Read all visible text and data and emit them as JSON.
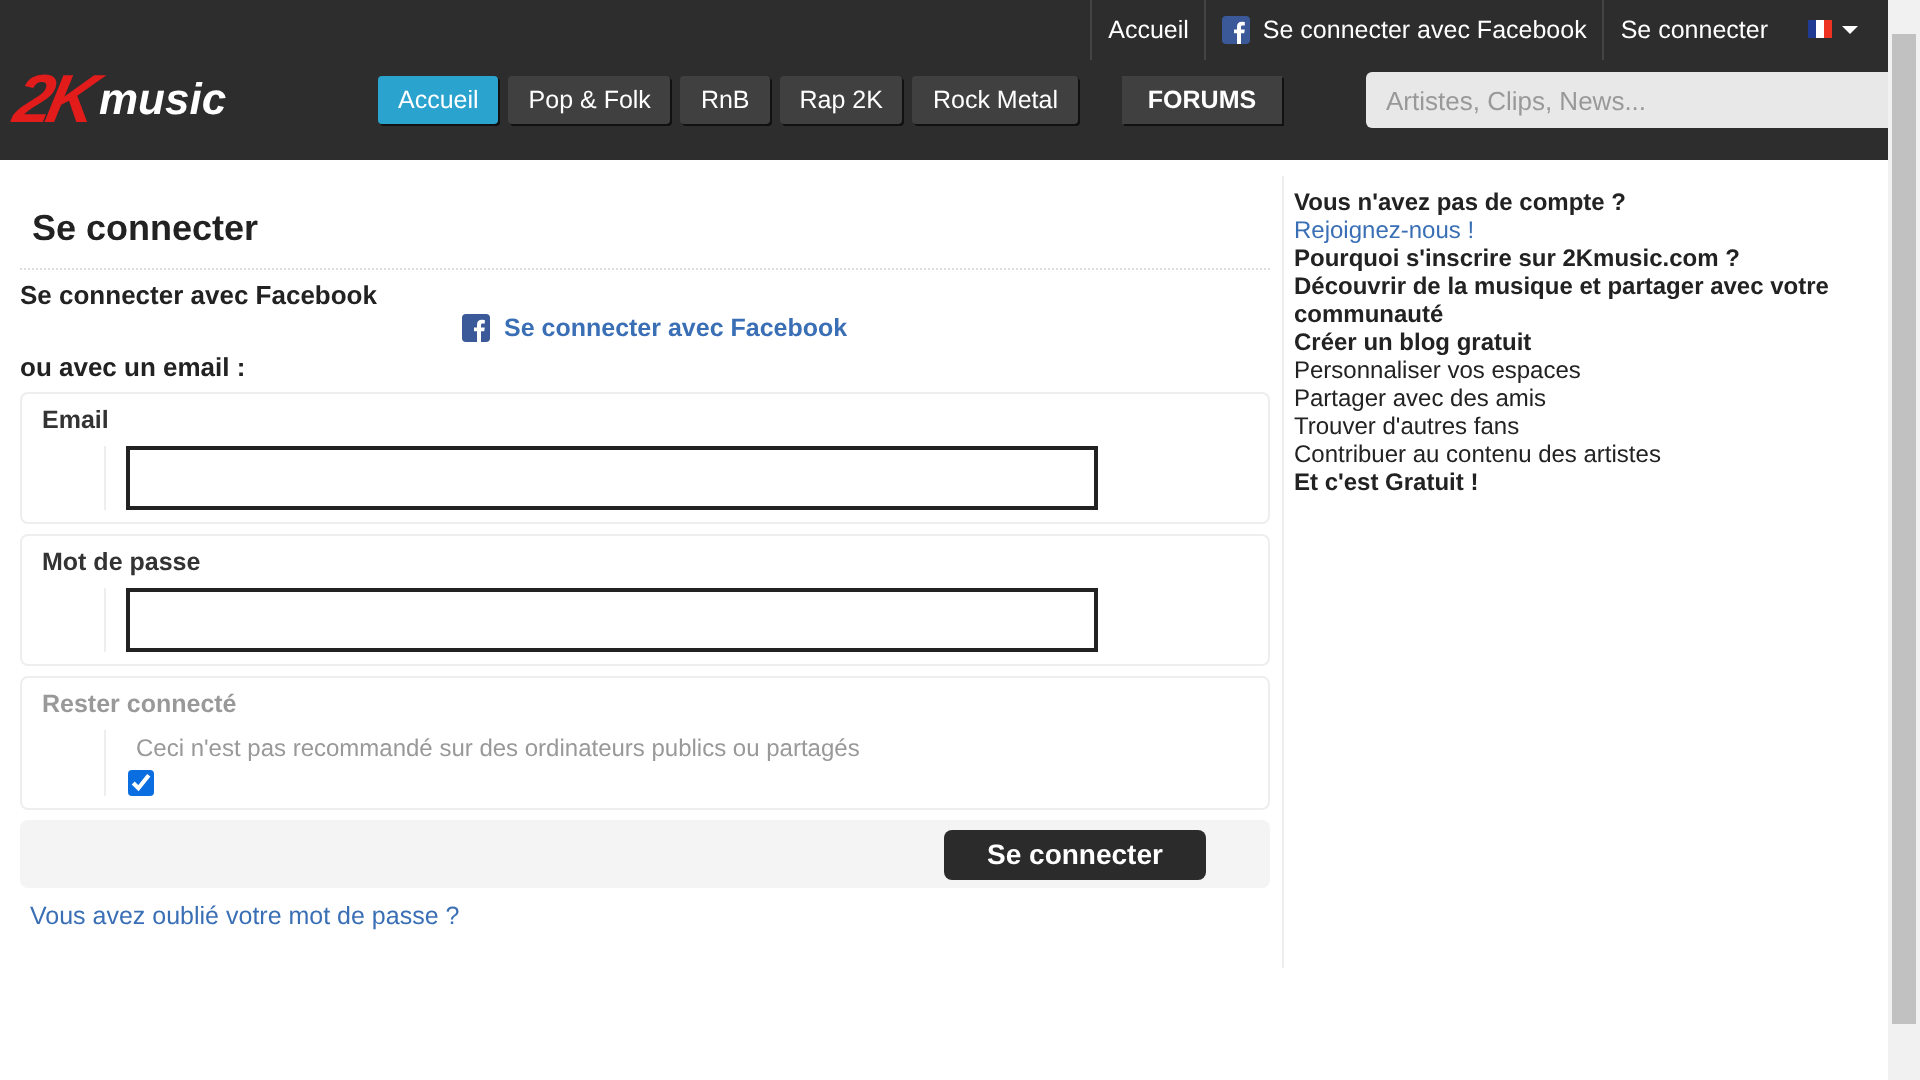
{
  "top_links": [
    "Accueil",
    "Se connecter avec Facebook",
    "Se connecter"
  ],
  "logo": {
    "mark": "2K",
    "word": "music"
  },
  "nav": [
    {
      "label": "Accueil",
      "selected": true
    },
    {
      "label": "Pop & Folk",
      "selected": false
    },
    {
      "label": "RnB",
      "selected": false
    },
    {
      "label": "Rap 2K",
      "selected": false
    },
    {
      "label": "Rock Metal",
      "selected": false
    }
  ],
  "forums": "FORUMS",
  "search": {
    "placeholder": "Artistes, Clips, News..."
  },
  "page_title": "Se connecter",
  "facebook_heading": "Se connecter avec Facebook",
  "facebook_link": "Se connecter avec Facebook",
  "email_heading": "ou avec un email :",
  "fields": [
    {
      "label": "Email"
    },
    {
      "label": "Mot de passe"
    }
  ],
  "remember": {
    "label": "Rester connecté",
    "note": "Ceci n'est pas recommandé sur des ordinateurs publics ou partagés",
    "checked": true
  },
  "submit": "Se connecter",
  "forgot": "Vous avez oublié votre mot de passe ?",
  "sidebar": [
    {
      "kind": "heading",
      "text": "Vous n'avez pas de compte ?"
    },
    {
      "kind": "link",
      "text": "Rejoignez-nous !"
    },
    {
      "kind": "heading",
      "text": "Pourquoi s'inscrire sur 2Kmusic.com ?"
    },
    {
      "kind": "heading",
      "text": "Découvrir de la musique et partager avec votre communauté"
    },
    {
      "kind": "heading",
      "text": "Créer un blog gratuit"
    },
    {
      "kind": "plain",
      "text": "Personnaliser vos espaces"
    },
    {
      "kind": "plain",
      "text": "Partager avec des amis"
    },
    {
      "kind": "plain",
      "text": "Trouver d'autres fans"
    },
    {
      "kind": "plain",
      "text": "Contribuer au contenu des artistes"
    },
    {
      "kind": "heading",
      "text": "Et c'est Gratuit !"
    }
  ]
}
